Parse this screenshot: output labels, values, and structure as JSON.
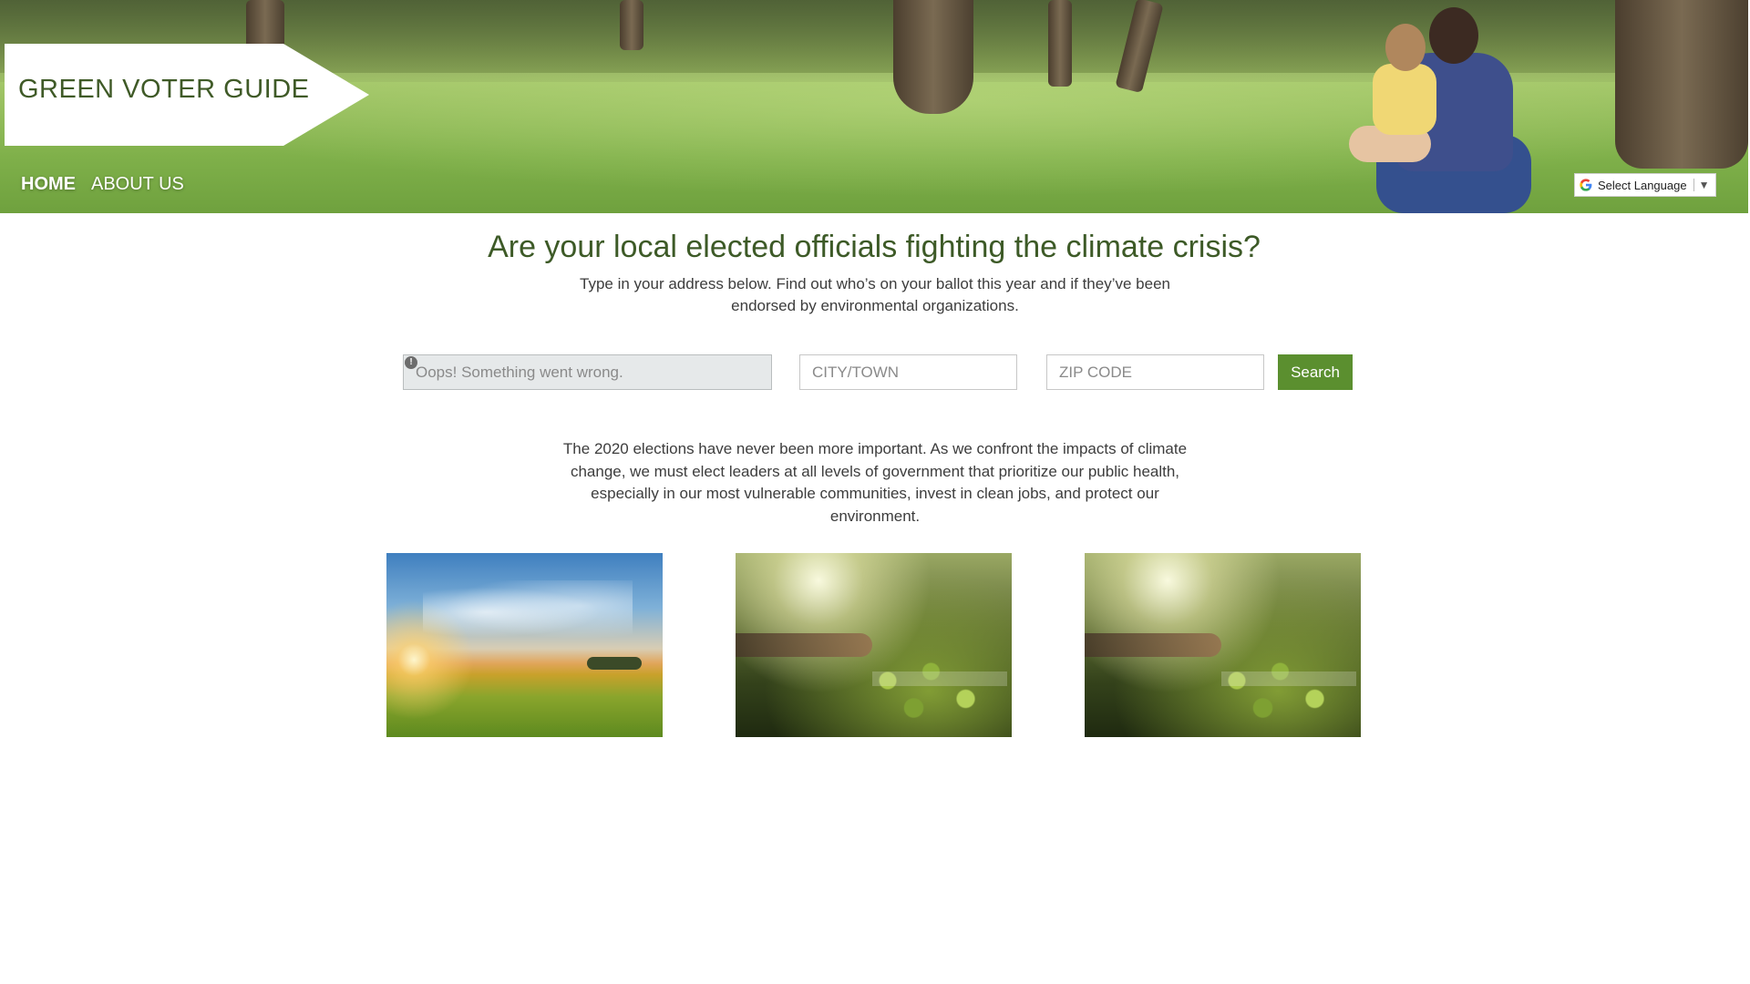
{
  "site": {
    "title": "GREEN VOTER GUIDE"
  },
  "nav": {
    "items": [
      {
        "label": "HOME",
        "active": true
      },
      {
        "label": "ABOUT US",
        "active": false
      }
    ]
  },
  "language_selector": {
    "label": "Select Language",
    "caret": "▼",
    "icon": "google-g-icon"
  },
  "main": {
    "headline": "Are your local elected officials fighting the climate crisis?",
    "subhead": "Type in your address below. Find out who’s on your ballot this year and if they’ve been endorsed by environmental organizations.",
    "body": "The 2020 elections have never been more important. As we confront the impacts of climate change, we must elect leaders at all levels of government that prioritize our public health, especially in our most vulnerable communities, invest in clean jobs, and protect our environment."
  },
  "search": {
    "address_placeholder": "Oops! Something went wrong.",
    "address_error_badge": "!",
    "city_placeholder": "CITY/TOWN",
    "zip_placeholder": "ZIP CODE",
    "button_label": "Search"
  },
  "images": [
    {
      "name": "sunset-field-photo"
    },
    {
      "name": "hand-plants-photo"
    },
    {
      "name": "hand-plants-photo"
    }
  ],
  "colors": {
    "brand_green": "#3d5a27",
    "button_green": "#5b8f2f"
  }
}
